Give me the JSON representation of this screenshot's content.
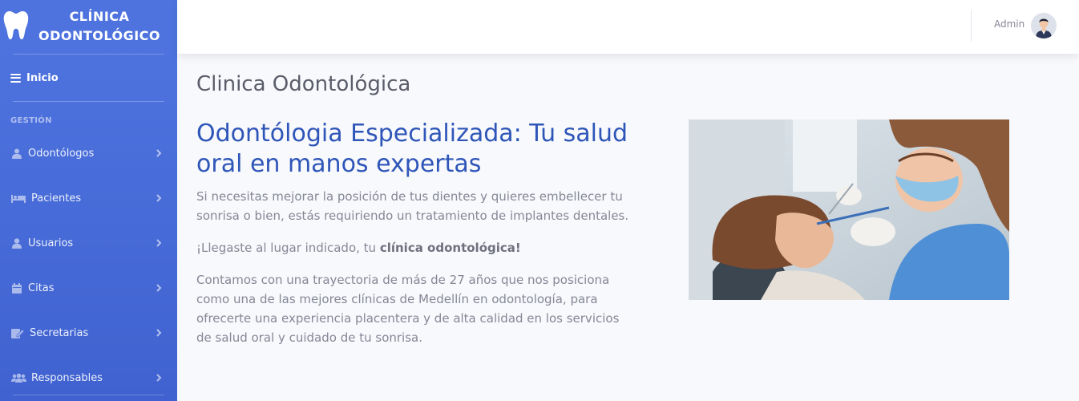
{
  "brand": {
    "line1": "CLÍNICA",
    "line2": "ODONTOLÓGICO"
  },
  "nav": {
    "home_label": "Inicio",
    "section_heading": "GESTIÓN",
    "items": [
      {
        "label": "Odontólogos",
        "icon": "user-doctor-icon"
      },
      {
        "label": "Pacientes",
        "icon": "bed-icon"
      },
      {
        "label": "Usuarios",
        "icon": "user-icon"
      },
      {
        "label": "Citas",
        "icon": "calendar-icon"
      },
      {
        "label": "Secretarias",
        "icon": "edit-icon"
      },
      {
        "label": "Responsables",
        "icon": "users-icon"
      }
    ]
  },
  "topbar": {
    "user_name": "Admin"
  },
  "main": {
    "page_title": "Clinica Odontológica",
    "headline": "Odontólogia Especializada: Tu salud oral en manos expertas",
    "paragraph1": "Si necesitas mejorar la posición de tus dientes y quieres embellecer tu sonrisa o bien, estás requiriendo un tratamiento de implantes dentales.",
    "paragraph2_prefix": "¡Llegaste al lugar indicado, tu ",
    "paragraph2_bold": "clínica odontológica!",
    "paragraph3": "Contamos con una trayectoria de más de 27 años que nos posiciona como una de las mejores clínicas de Medellín en odontología, para ofrecerte una experiencia placentera y de alta calidad en los servicios de salud oral y cuidado de tu sonrisa."
  },
  "colors": {
    "sidebar": "#4e73df",
    "headline": "#2e55b8",
    "text": "#858796"
  }
}
